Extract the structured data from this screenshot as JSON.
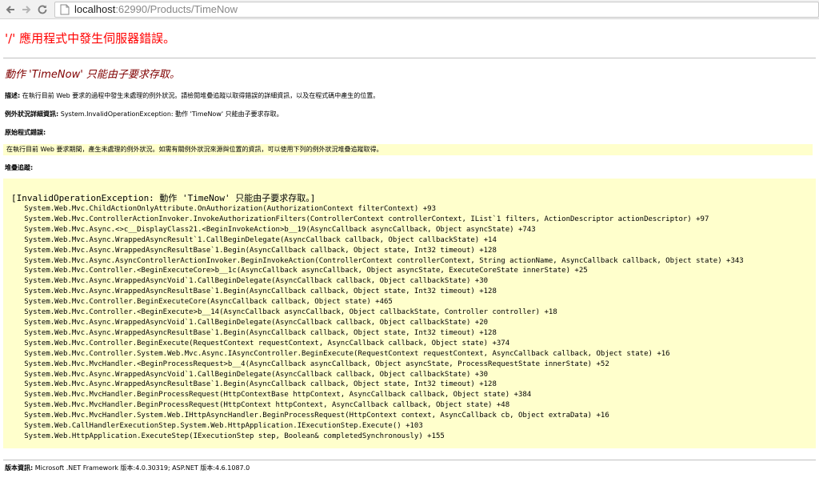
{
  "browser": {
    "url_host": "localhost",
    "url_rest": ":62990/Products/TimeNow"
  },
  "page": {
    "error_title": "'/' 應用程式中發生伺服器錯誤。",
    "error_heading": "動作 'TimeNow' 只能由子要求存取。",
    "description_label": "描述:",
    "description_text": " 在執行目前 Web 要求的過程中發生未處理的例外狀況。請檢閱堆疊追蹤以取得錯誤的詳細資訊，以及在程式碼中產生的位置。",
    "exception_label": "例外狀況詳細資訊:",
    "exception_text": " System.InvalidOperationException: 動作 'TimeNow' 只能由子要求存取。",
    "source_label": "原始程式錯誤:",
    "source_text": "在執行目前 Web 要求期間，產生未處理的例外狀況。如需有關例外狀況來源與位置的資訊，可以使用下列的例外狀況堆疊追蹤取得。",
    "stack_label": "堆疊追蹤:",
    "stack_header": "[InvalidOperationException: 動作 'TimeNow' 只能由子要求存取。]",
    "stack_lines": [
      "   System.Web.Mvc.ChildActionOnlyAttribute.OnAuthorization(AuthorizationContext filterContext) +93",
      "   System.Web.Mvc.ControllerActionInvoker.InvokeAuthorizationFilters(ControllerContext controllerContext, IList`1 filters, ActionDescriptor actionDescriptor) +97",
      "   System.Web.Mvc.Async.<>c__DisplayClass21.<BeginInvokeAction>b__19(AsyncCallback asyncCallback, Object asyncState) +743",
      "   System.Web.Mvc.Async.WrappedAsyncResult`1.CallBeginDelegate(AsyncCallback callback, Object callbackState) +14",
      "   System.Web.Mvc.Async.WrappedAsyncResultBase`1.Begin(AsyncCallback callback, Object state, Int32 timeout) +128",
      "   System.Web.Mvc.Async.AsyncControllerActionInvoker.BeginInvokeAction(ControllerContext controllerContext, String actionName, AsyncCallback callback, Object state) +343",
      "   System.Web.Mvc.Controller.<BeginExecuteCore>b__1c(AsyncCallback asyncCallback, Object asyncState, ExecuteCoreState innerState) +25",
      "   System.Web.Mvc.Async.WrappedAsyncVoid`1.CallBeginDelegate(AsyncCallback callback, Object callbackState) +30",
      "   System.Web.Mvc.Async.WrappedAsyncResultBase`1.Begin(AsyncCallback callback, Object state, Int32 timeout) +128",
      "   System.Web.Mvc.Controller.BeginExecuteCore(AsyncCallback callback, Object state) +465",
      "   System.Web.Mvc.Controller.<BeginExecute>b__14(AsyncCallback asyncCallback, Object callbackState, Controller controller) +18",
      "   System.Web.Mvc.Async.WrappedAsyncVoid`1.CallBeginDelegate(AsyncCallback callback, Object callbackState) +20",
      "   System.Web.Mvc.Async.WrappedAsyncResultBase`1.Begin(AsyncCallback callback, Object state, Int32 timeout) +128",
      "   System.Web.Mvc.Controller.BeginExecute(RequestContext requestContext, AsyncCallback callback, Object state) +374",
      "   System.Web.Mvc.Controller.System.Web.Mvc.Async.IAsyncController.BeginExecute(RequestContext requestContext, AsyncCallback callback, Object state) +16",
      "   System.Web.Mvc.MvcHandler.<BeginProcessRequest>b__4(AsyncCallback asyncCallback, Object asyncState, ProcessRequestState innerState) +52",
      "   System.Web.Mvc.Async.WrappedAsyncVoid`1.CallBeginDelegate(AsyncCallback callback, Object callbackState) +30",
      "   System.Web.Mvc.Async.WrappedAsyncResultBase`1.Begin(AsyncCallback callback, Object state, Int32 timeout) +128",
      "   System.Web.Mvc.MvcHandler.BeginProcessRequest(HttpContextBase httpContext, AsyncCallback callback, Object state) +384",
      "   System.Web.Mvc.MvcHandler.BeginProcessRequest(HttpContext httpContext, AsyncCallback callback, Object state) +48",
      "   System.Web.Mvc.MvcHandler.System.Web.IHttpAsyncHandler.BeginProcessRequest(HttpContext context, AsyncCallback cb, Object extraData) +16",
      "   System.Web.CallHandlerExecutionStep.System.Web.HttpApplication.IExecutionStep.Execute() +103",
      "   System.Web.HttpApplication.ExecuteStep(IExecutionStep step, Boolean& completedSynchronously) +155"
    ],
    "version_label": "版本資訊:",
    "version_text": " Microsoft .NET Framework 版本:4.0.30319; ASP.NET 版本:4.6.1087.0"
  },
  "colors": {
    "title_red": "#ff0000",
    "heading_maroon": "#800000",
    "highlight_yellow": "#ffffcc"
  },
  "icons": [
    "back-arrow-icon",
    "forward-arrow-icon",
    "reload-icon",
    "page-icon"
  ]
}
